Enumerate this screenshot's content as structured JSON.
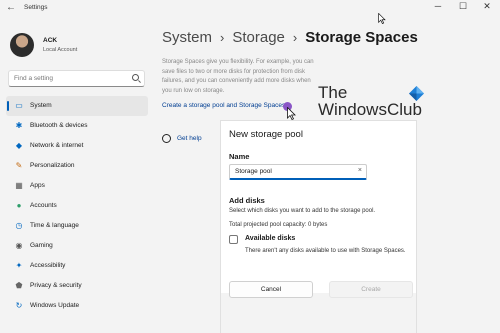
{
  "window": {
    "app_title": "Settings",
    "back_icon": "back-arrow-icon",
    "controls": {
      "minimize": "─",
      "maximize": "☐",
      "close": "✕"
    }
  },
  "profile": {
    "name": "ACK",
    "account_type": "Local Account"
  },
  "search": {
    "placeholder": "Find a setting"
  },
  "sidebar": {
    "items": [
      {
        "label": "System",
        "icon": "monitor-icon",
        "glyph": "▭",
        "color": "#0067c0",
        "active": true
      },
      {
        "label": "Bluetooth & devices",
        "icon": "bluetooth-icon",
        "glyph": "✱",
        "color": "#0067c0"
      },
      {
        "label": "Network & internet",
        "icon": "wifi-icon",
        "glyph": "◆",
        "color": "#0067c0"
      },
      {
        "label": "Personalization",
        "icon": "brush-icon",
        "glyph": "✎",
        "color": "#c36a12"
      },
      {
        "label": "Apps",
        "icon": "apps-icon",
        "glyph": "▦",
        "color": "#555555"
      },
      {
        "label": "Accounts",
        "icon": "person-icon",
        "glyph": "●",
        "color": "#2e9e6a"
      },
      {
        "label": "Time & language",
        "icon": "clock-globe-icon",
        "glyph": "◷",
        "color": "#0067c0"
      },
      {
        "label": "Gaming",
        "icon": "gamepad-icon",
        "glyph": "◉",
        "color": "#555555"
      },
      {
        "label": "Accessibility",
        "icon": "accessibility-icon",
        "glyph": "✦",
        "color": "#0067c0"
      },
      {
        "label": "Privacy & security",
        "icon": "shield-icon",
        "glyph": "⬟",
        "color": "#666666"
      },
      {
        "label": "Windows Update",
        "icon": "update-icon",
        "glyph": "↻",
        "color": "#0067c0"
      }
    ]
  },
  "breadcrumb": {
    "level1": "System",
    "level2": "Storage",
    "current": "Storage Spaces",
    "separator": "›"
  },
  "main": {
    "description": "Storage Spaces give you flexibility. For example, you can save files to two or more disks for protection from disk failures, and you can conveniently add more disks when you run low on storage.",
    "create_link": "Create a storage pool and Storage Spaces",
    "help_label": "Get help"
  },
  "dialog": {
    "title": "New storage pool",
    "name_label": "Name",
    "name_value": "Storage pool",
    "clear_glyph": "×",
    "add_disks_title": "Add disks",
    "add_disks_desc": "Select which disks you want to add to the storage pool.",
    "capacity": "Total projected pool capacity: 0 bytes",
    "available_title": "Available disks",
    "available_desc": "There aren't any disks available to use with Storage Spaces.",
    "cancel": "Cancel",
    "create": "Create"
  },
  "watermark": {
    "line1": "The",
    "line2": "WindowsClub"
  },
  "colors": {
    "accent": "#005fb8",
    "link": "#003e92",
    "background": "#f3f3f3"
  }
}
